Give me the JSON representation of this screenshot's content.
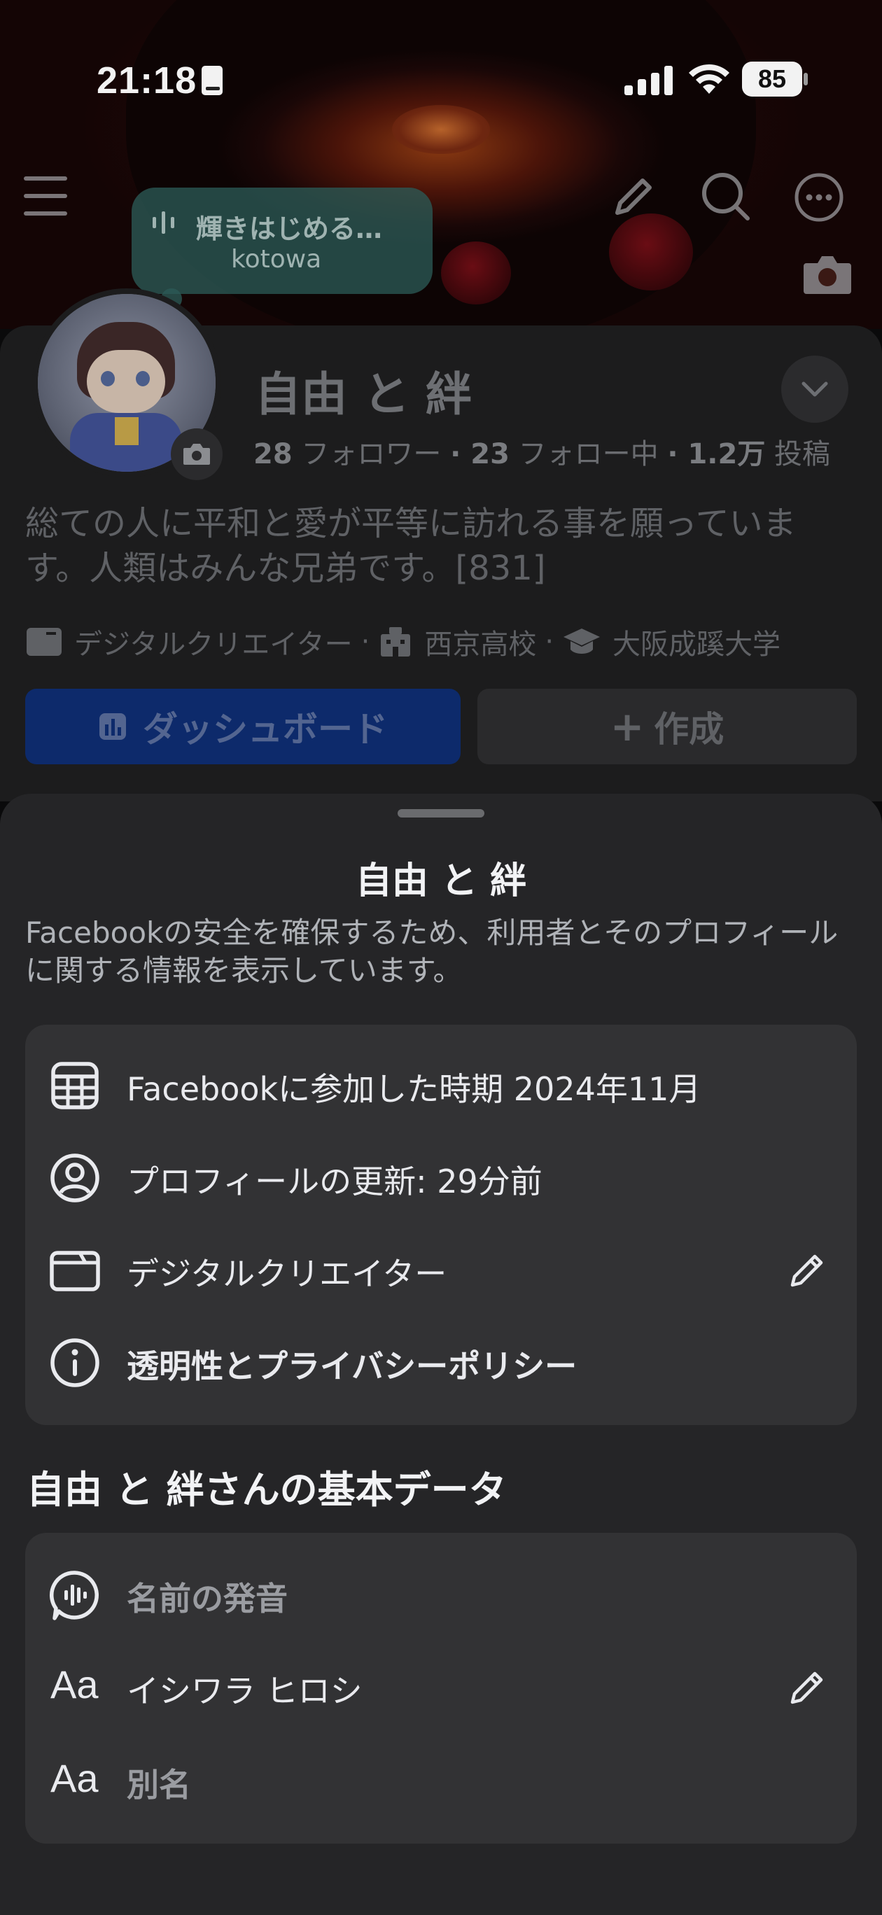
{
  "status_bar": {
    "time": "21:18",
    "battery": "85"
  },
  "music_note": {
    "title": "輝きはじめる…",
    "artist": "kotowa"
  },
  "profile": {
    "name": "自由 と 絆",
    "followers_count": "28",
    "followers_label": "フォロワー",
    "following_count": "23",
    "following_label": "フォロー中",
    "posts_count": "1.2万",
    "posts_label": "投稿",
    "bio": "総ての人に平和と愛が平等に訪れる事を願っています。人類はみんな兄弟です。[831]",
    "meta": {
      "category": "デジタルクリエイター",
      "school": "西京高校",
      "university": "大阪成蹊大学"
    },
    "dashboard_button": "ダッシュボード",
    "create_button": "作成"
  },
  "sheet": {
    "title": "自由 と 絆",
    "description": "Facebookの安全を確保するため、利用者とそのプロフィールに関する情報を表示しています。",
    "info_rows": [
      {
        "icon": "calendar-icon",
        "label": "Facebookに参加した時期 2024年11月"
      },
      {
        "icon": "profile-circle-icon",
        "label": "プロフィールの更新: 29分前"
      },
      {
        "icon": "category-card-icon",
        "label": "デジタルクリエイター"
      },
      {
        "icon": "info-icon",
        "label": "透明性とプライバシーポリシー"
      }
    ],
    "basic_title": "自由 と 絆さんの基本データ",
    "basic_rows": [
      {
        "icon": "voice-bubble-icon",
        "label": "名前の発音"
      },
      {
        "icon": "text-aa-icon",
        "label": "イシワラ ヒロシ",
        "icon_text": "Aa"
      },
      {
        "icon": "text-aa-icon",
        "label": "別名",
        "icon_text": "Aa"
      }
    ]
  },
  "colors": {
    "sheet_bg": "#252527",
    "group_bg": "#323234",
    "dashboard_blue": "#0d2a6b"
  }
}
